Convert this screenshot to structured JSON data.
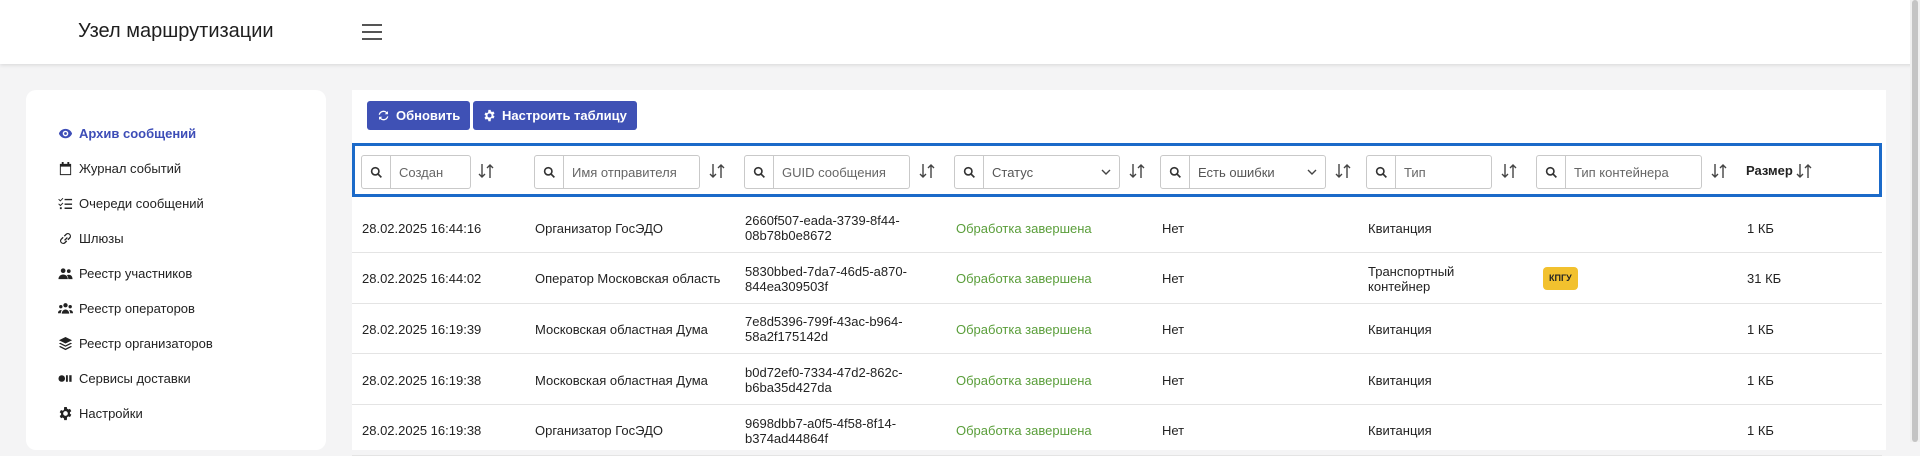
{
  "header": {
    "title": "Узел маршрутизации"
  },
  "sidebar": {
    "items": [
      {
        "label": "Архив сообщений",
        "icon": "eye-icon",
        "active": true
      },
      {
        "label": "Журнал событий",
        "icon": "calendar-icon"
      },
      {
        "label": "Очереди сообщений",
        "icon": "list-check-icon"
      },
      {
        "label": "Шлюзы",
        "icon": "link-icon"
      },
      {
        "label": "Реестр участников",
        "icon": "users-icon"
      },
      {
        "label": "Реестр операторов",
        "icon": "user-group-icon"
      },
      {
        "label": "Реестр организаторов",
        "icon": "layers-icon"
      },
      {
        "label": "Сервисы доставки",
        "icon": "delivery-icon"
      },
      {
        "label": "Настройки",
        "icon": "gear-icon"
      }
    ]
  },
  "toolbar": {
    "refresh_label": "Обновить",
    "configure_label": "Настроить таблицу"
  },
  "filters": {
    "created": "Создан",
    "sender": "Имя отправителя",
    "guid": "GUID сообщения",
    "status": "Статус",
    "has_errors": "Есть ошибки",
    "type": "Тип",
    "container_type": "Тип контейнера",
    "size": "Размер"
  },
  "accent": "#3f51b5",
  "status_color": "#5a9e3a",
  "rows": [
    {
      "created": "28.02.2025 16:44:16",
      "sender": "Организатор ГосЭДО",
      "guid1": "2660f507-eada-3739-8f44-",
      "guid2": "08b78b0e8672",
      "status": "Обработка завершена",
      "errors": "Нет",
      "type1": "Квитанция",
      "type2": "",
      "container": "",
      "size": "1 КБ"
    },
    {
      "created": "28.02.2025 16:44:02",
      "sender": "Оператор Московская область",
      "guid1": "5830bbed-7da7-46d5-a870-",
      "guid2": "844ea309503f",
      "status": "Обработка завершена",
      "errors": "Нет",
      "type1": "Транспортный",
      "type2": "контейнер",
      "container": "КПГУ",
      "size": "31 КБ"
    },
    {
      "created": "28.02.2025 16:19:39",
      "sender": "Московская областная Дума",
      "guid1": "7e8d5396-799f-43ac-b964-",
      "guid2": "58a2f175142d",
      "status": "Обработка завершена",
      "errors": "Нет",
      "type1": "Квитанция",
      "type2": "",
      "container": "",
      "size": "1 КБ"
    },
    {
      "created": "28.02.2025 16:19:38",
      "sender": "Московская областная Дума",
      "guid1": "b0d72ef0-7334-47d2-862c-",
      "guid2": "b6ba35d427da",
      "status": "Обработка завершена",
      "errors": "Нет",
      "type1": "Квитанция",
      "type2": "",
      "container": "",
      "size": "1 КБ"
    },
    {
      "created": "28.02.2025 16:19:38",
      "sender": "Организатор ГосЭДО",
      "guid1": "9698dbb7-a0f5-4f58-8f14-",
      "guid2": "b374ad44864f",
      "status": "Обработка завершена",
      "errors": "Нет",
      "type1": "Квитанция",
      "type2": "",
      "container": "",
      "size": "1 КБ"
    }
  ]
}
